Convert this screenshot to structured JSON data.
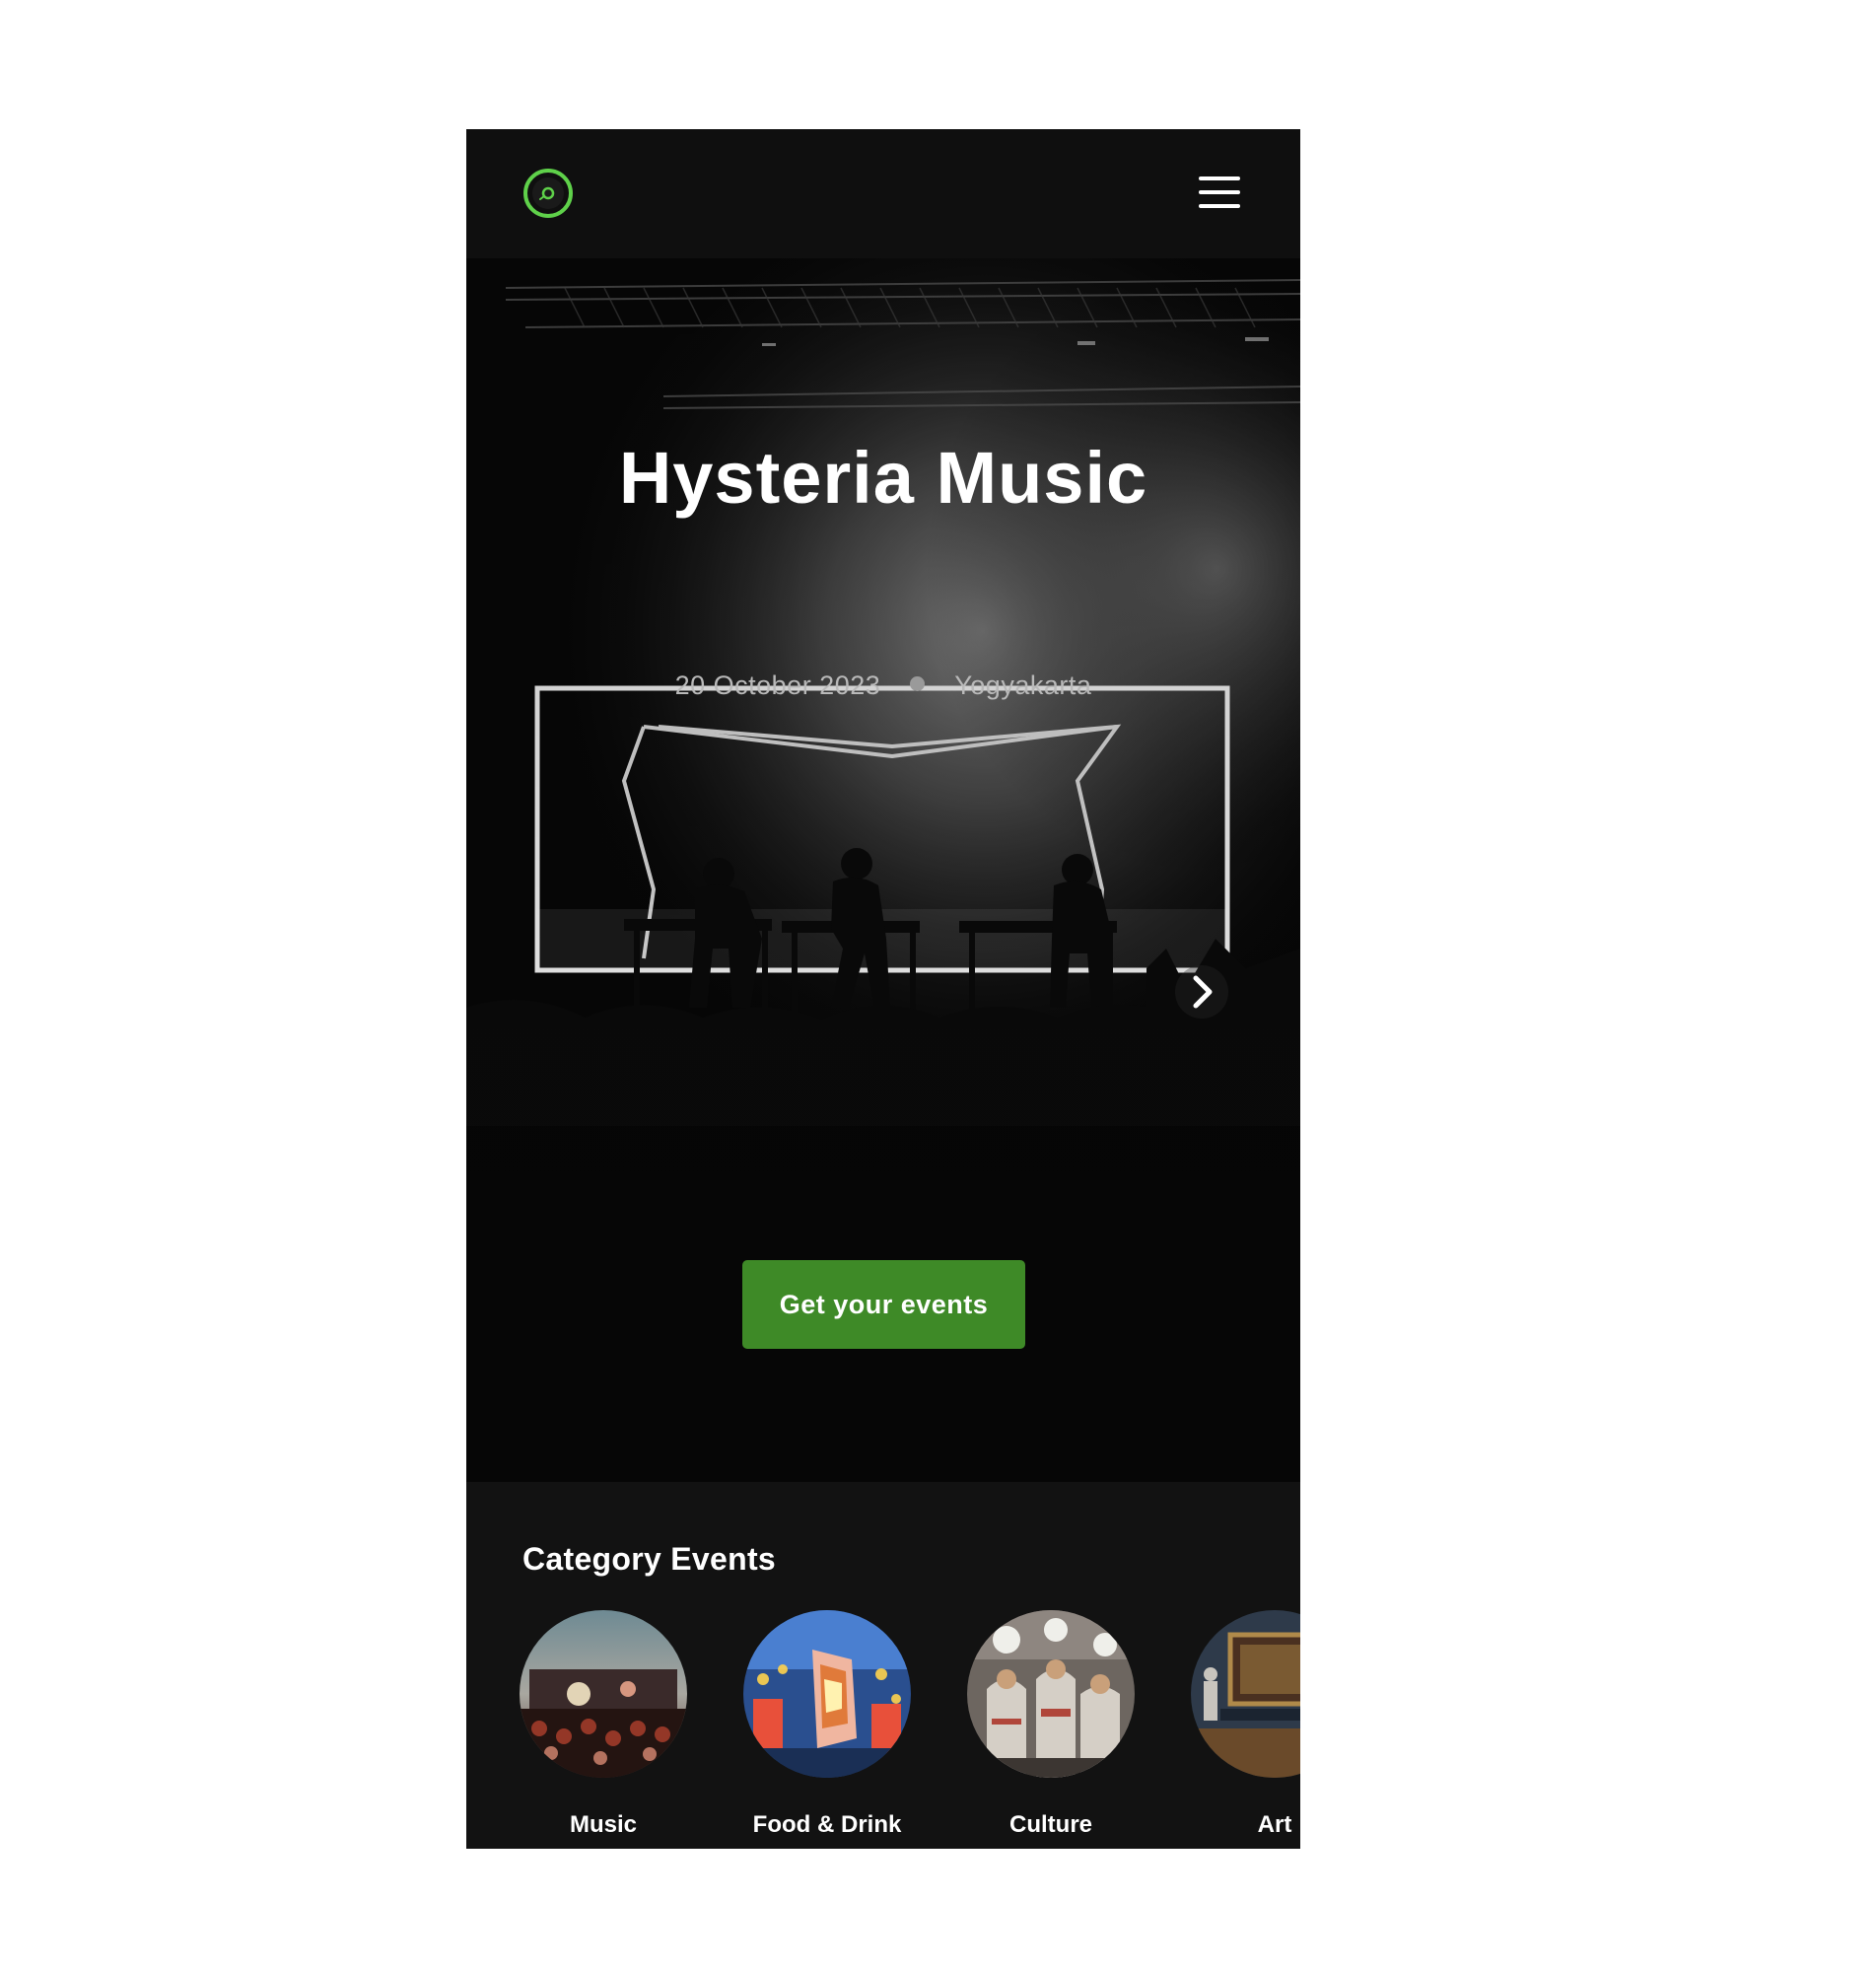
{
  "header": {
    "logo_icon": "vinyl-disc-icon",
    "menu_icon": "hamburger-menu-icon",
    "accent_color": "#5fd14a"
  },
  "hero": {
    "title": "Hysteria Music",
    "date": "20 October 2023",
    "location": "Yogyakarta",
    "next_icon": "chevron-right-icon",
    "cta_label": "Get your events",
    "cta_color": "#3e8a27",
    "slides_total": 3,
    "active_slide": 1
  },
  "categories": {
    "title": "Category Events",
    "items": [
      {
        "label": "Music"
      },
      {
        "label": "Food & Drink"
      },
      {
        "label": "Culture"
      },
      {
        "label": "Art"
      }
    ]
  }
}
